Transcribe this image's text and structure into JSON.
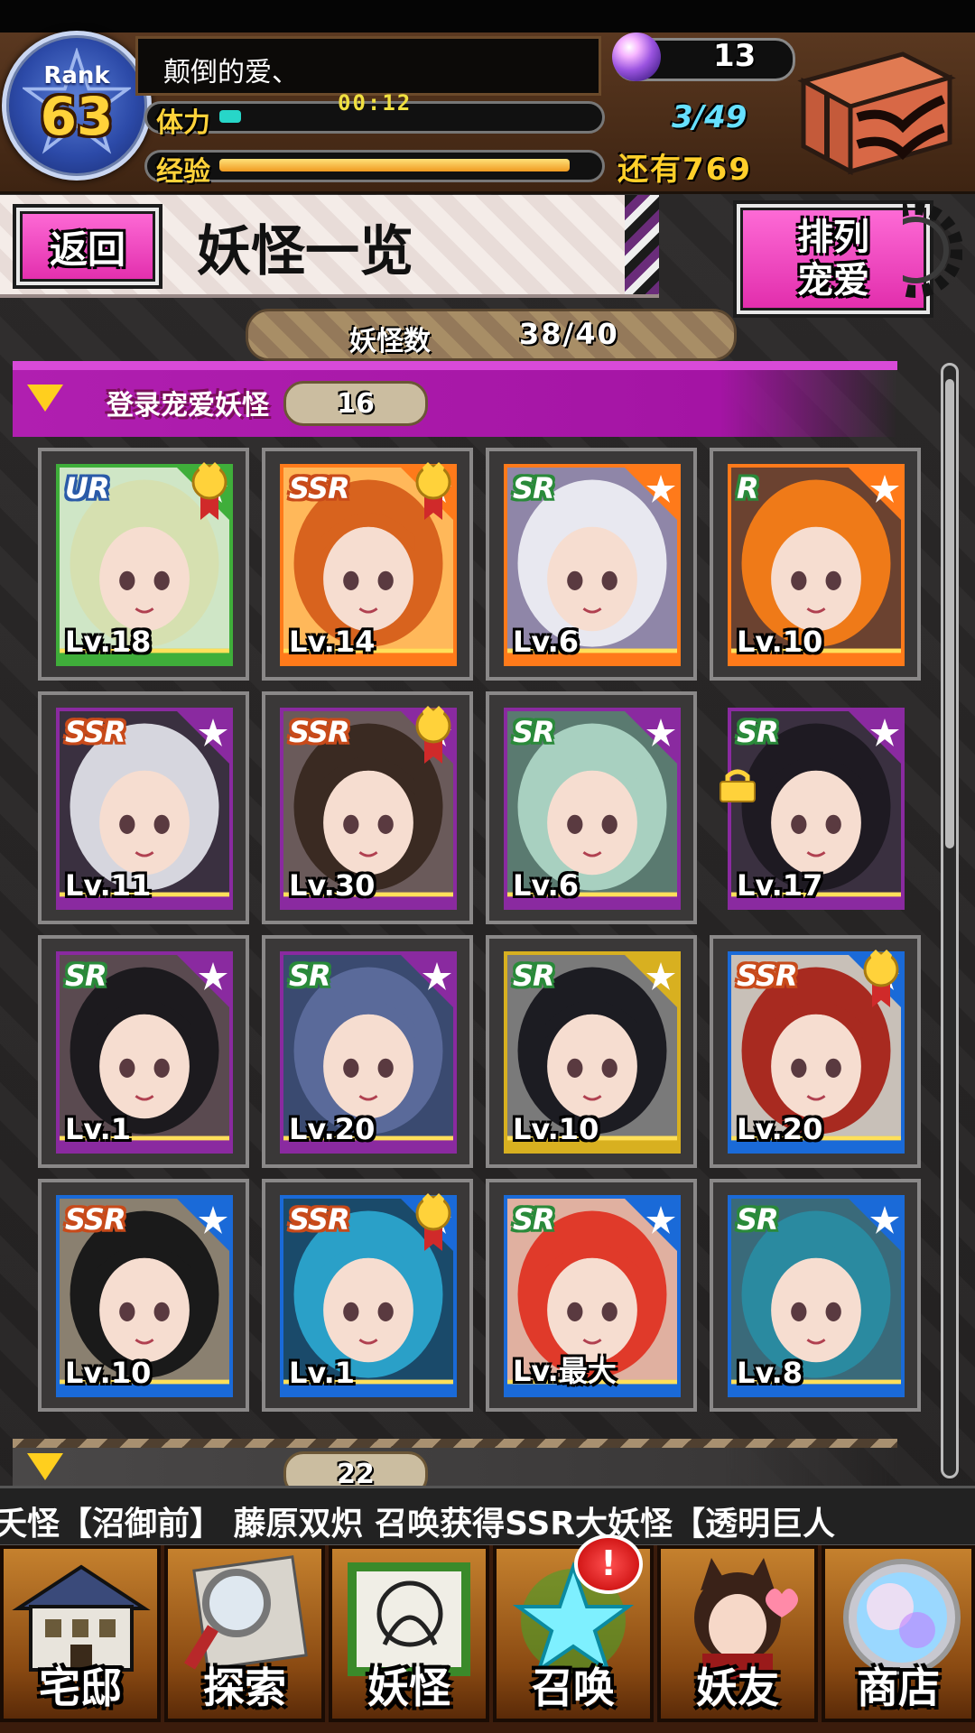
{
  "header": {
    "rank_label": "Rank",
    "rank_value": "63",
    "player_name": "颠倒的爱、",
    "stamina_label": "体力",
    "stamina_timer": "00:12",
    "stamina_value": "3/49",
    "stamina_fraction": 0.06,
    "exp_label": "经验",
    "exp_remaining": "还有769",
    "exp_fraction": 0.96,
    "gems": "13"
  },
  "page": {
    "back_label": "返回",
    "title": "妖怪一览",
    "sort_label_1": "排列",
    "sort_label_2": "宠爱",
    "count_label": "妖怪数",
    "count_value": "38/40"
  },
  "section_favorites": {
    "label": "登录宠爱妖怪",
    "count": "16"
  },
  "section_unregistered": {
    "count": "22"
  },
  "cards": [
    {
      "rarity": "UR",
      "level": "Lv.18",
      "frame": "#3fae3a",
      "bg": "#cfe6c6",
      "hair": "#d6e0b0",
      "medal": true
    },
    {
      "rarity": "SSR",
      "level": "Lv.14",
      "frame": "#ff7a1a",
      "bg": "#ffb85a",
      "hair": "#d8631e",
      "medal": true
    },
    {
      "rarity": "SR",
      "level": "Lv.6",
      "frame": "#ff7a1a",
      "bg": "#8f86a8",
      "hair": "#e8e8f0",
      "medal": false
    },
    {
      "rarity": "R",
      "level": "Lv.10",
      "frame": "#ff7a1a",
      "bg": "#6b4230",
      "hair": "#ef7a18",
      "medal": false
    },
    {
      "rarity": "SSR",
      "level": "Lv.11",
      "frame": "#8a2aa0",
      "bg": "#3a3040",
      "hair": "#d6d6de",
      "medal": false
    },
    {
      "rarity": "SSR",
      "level": "Lv.30",
      "frame": "#8a2aa0",
      "bg": "#6a5a5a",
      "hair": "#3a2a22",
      "medal": true
    },
    {
      "rarity": "SR",
      "level": "Lv.6",
      "frame": "#8a2aa0",
      "bg": "#5a7a70",
      "hair": "#a8d0c0",
      "medal": false
    },
    {
      "rarity": "SR",
      "level": "Lv.17",
      "frame": "#8a2aa0",
      "bg": "#3a3040",
      "hair": "#1e1a22",
      "medal": false,
      "locked": true
    },
    {
      "rarity": "SR",
      "level": "Lv.1",
      "frame": "#8a2aa0",
      "bg": "#5a4a50",
      "hair": "#1c1a1e",
      "medal": false
    },
    {
      "rarity": "SR",
      "level": "Lv.20",
      "frame": "#8a2aa0",
      "bg": "#3a4a70",
      "hair": "#5a6a9a",
      "medal": false
    },
    {
      "rarity": "SR",
      "level": "Lv.10",
      "frame": "#d8b020",
      "bg": "#7a7a7a",
      "hair": "#1c1c22",
      "medal": false
    },
    {
      "rarity": "SSR",
      "level": "Lv.20",
      "frame": "#1a6ad8",
      "bg": "#c8c0b8",
      "hair": "#a82a20",
      "medal": true
    },
    {
      "rarity": "SSR",
      "level": "Lv.10",
      "frame": "#1a6ad8",
      "bg": "#8a8070",
      "hair": "#1a1a1a",
      "medal": false
    },
    {
      "rarity": "SSR",
      "level": "Lv.1",
      "frame": "#1a6ad8",
      "bg": "#1a4a6a",
      "hair": "#2aa0c8",
      "medal": true
    },
    {
      "rarity": "SR",
      "level": "Lv.最大",
      "frame": "#1a6ad8",
      "bg": "#e0b0a0",
      "hair": "#e03a2a",
      "medal": false
    },
    {
      "rarity": "SR",
      "level": "Lv.8",
      "frame": "#1a6ad8",
      "bg": "#3a6a7a",
      "hair": "#2a8aa0",
      "medal": false
    }
  ],
  "ticker_text": "夭怪【沼御前】   藤原双炽 召唤获得SSR大妖怪【透明巨人",
  "nav": [
    {
      "label": "宅邸",
      "icon": "mansion-icon"
    },
    {
      "label": "探索",
      "icon": "magnifier-map-icon"
    },
    {
      "label": "妖怪",
      "icon": "scroll-icon"
    },
    {
      "label": "召唤",
      "icon": "pentagram-icon"
    },
    {
      "label": "妖友",
      "icon": "catgirl-friend-icon"
    },
    {
      "label": "商店",
      "icon": "crystal-orb-icon"
    }
  ],
  "nav_badge": "!"
}
